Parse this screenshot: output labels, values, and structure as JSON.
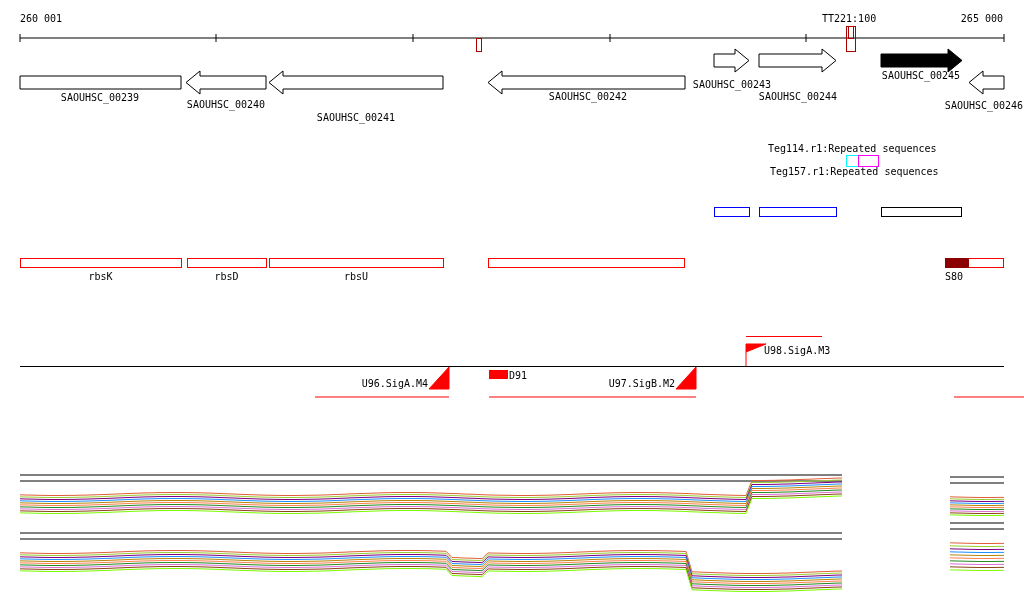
{
  "ruler": {
    "start_label": "260 001",
    "end_label": "265 000",
    "terminator_label": "TT221:100"
  },
  "genes": [
    {
      "name": "SAOUHSC_00239",
      "kind": "block",
      "filled": false
    },
    {
      "name": "SAOUHSC_00240",
      "kind": "reverse",
      "filled": false
    },
    {
      "name": "SAOUHSC_00241",
      "kind": "reverse",
      "filled": false
    },
    {
      "name": "SAOUHSC_00242",
      "kind": "reverse",
      "filled": false
    },
    {
      "name": "SAOUHSC_00243",
      "kind": "forward",
      "filled": false
    },
    {
      "name": "SAOUHSC_00244",
      "kind": "forward",
      "filled": false
    },
    {
      "name": "SAOUHSC_00245",
      "kind": "forward",
      "filled": true
    },
    {
      "name": "SAOUHSC_00246",
      "kind": "reverse",
      "filled": false
    }
  ],
  "repeats": [
    {
      "label": "Teg114.r1:Repeated sequences"
    },
    {
      "label": "Teg157.r1:Repeated sequences"
    }
  ],
  "rna_features": [
    {
      "label": "rbsK",
      "kind": "outline"
    },
    {
      "label": "rbsD",
      "kind": "outline"
    },
    {
      "label": "rbsU",
      "kind": "outline"
    },
    {
      "kind": "outline"
    },
    {
      "label": "S80",
      "kind": "split"
    }
  ],
  "promoters": [
    {
      "label": "U96.SigA.M4",
      "kind": "reverse"
    },
    {
      "label": "D91",
      "kind": "block"
    },
    {
      "label": "U97.SigB.M2",
      "kind": "reverse"
    },
    {
      "label": "U98.SigA.M3",
      "kind": "forward"
    }
  ]
}
